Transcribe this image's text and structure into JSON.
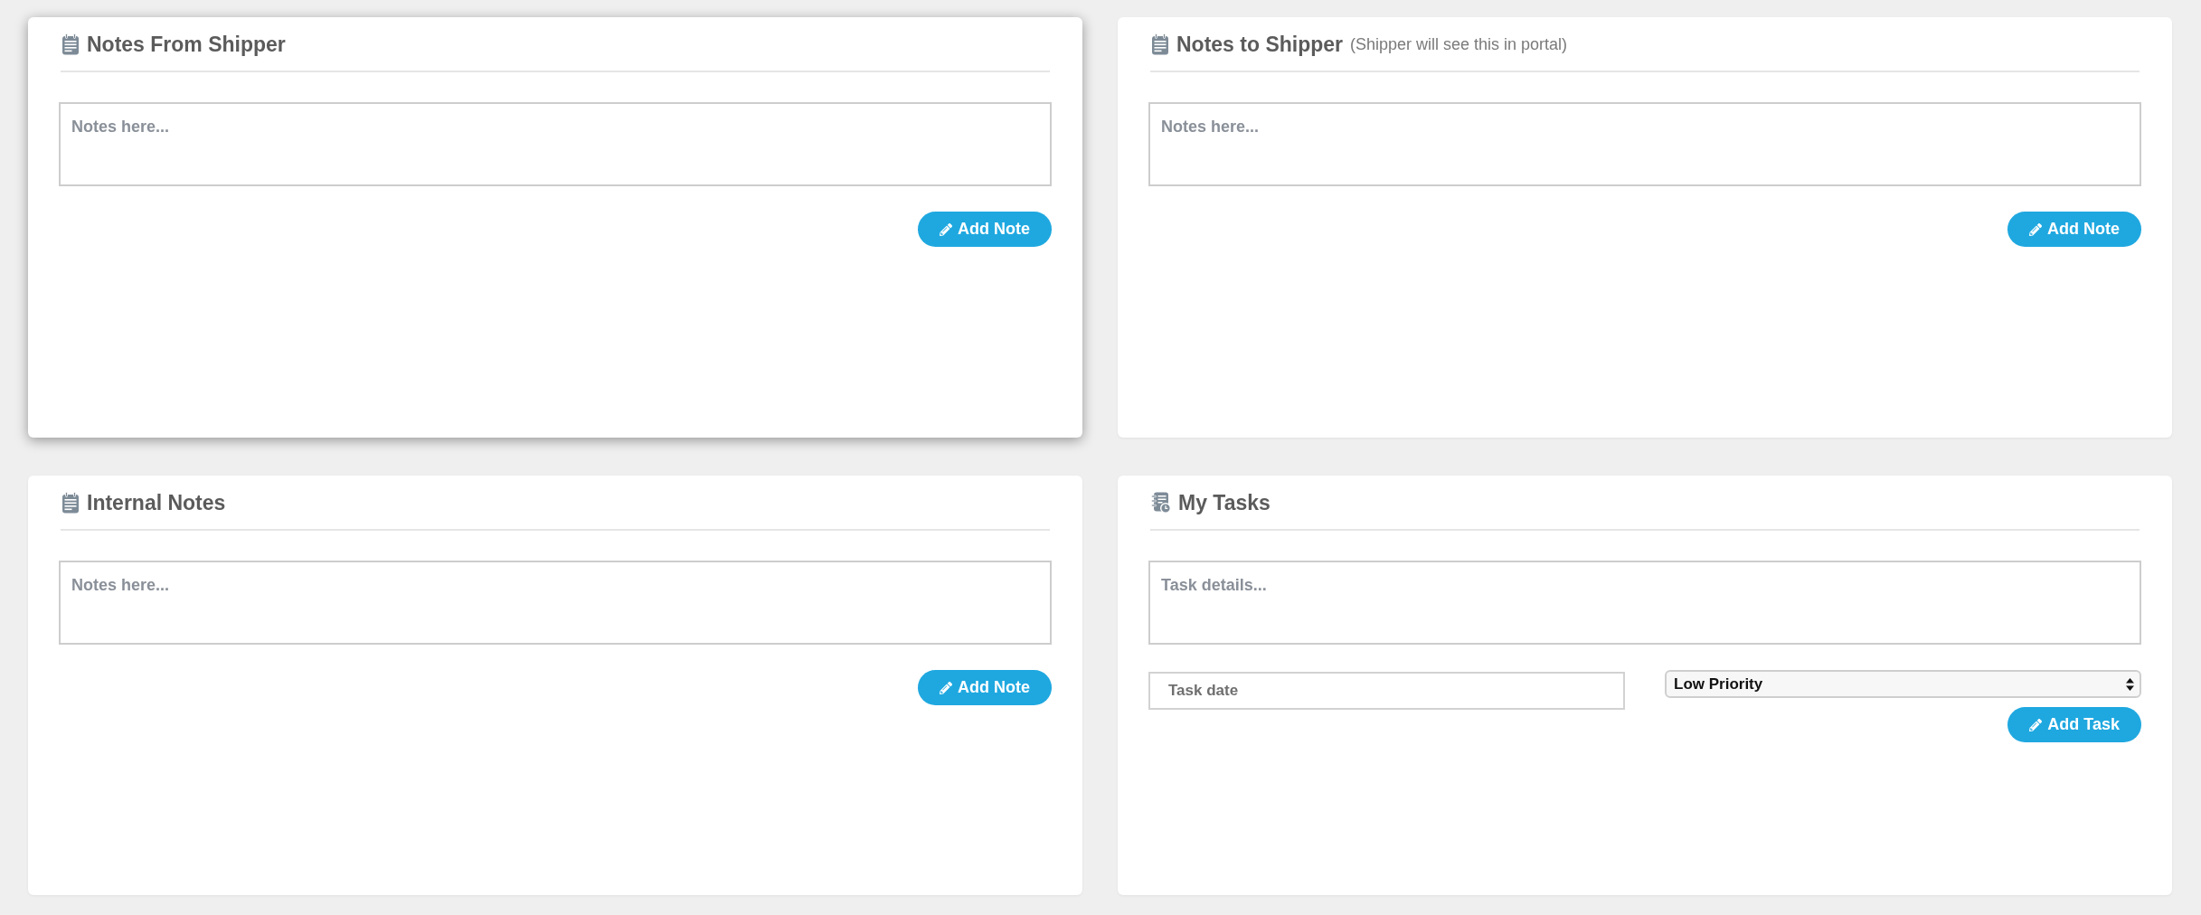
{
  "cards": [
    {
      "kind": "notes",
      "title": "Notes From Shipper",
      "hovered": true,
      "note_field": {
        "placeholder": "Notes here..."
      },
      "button": "Add Note"
    },
    {
      "kind": "notes",
      "title": "Notes to Shipper",
      "subtitle": "(Shipper will see this in portal)",
      "hovered": false,
      "note_field": {
        "placeholder": "Notes here..."
      },
      "button": "Add Note"
    },
    {
      "kind": "notes",
      "title": "Internal Notes",
      "hovered": false,
      "note_field": {
        "placeholder": "Notes here..."
      },
      "button": "Add Note"
    },
    {
      "kind": "tasks",
      "title": "My Tasks",
      "hovered": false,
      "details_field": {
        "placeholder": "Task details..."
      },
      "date_field": {
        "placeholder": "Task date"
      },
      "priority_select": {
        "value": "Low Priority"
      },
      "button": "Add Task"
    }
  ]
}
